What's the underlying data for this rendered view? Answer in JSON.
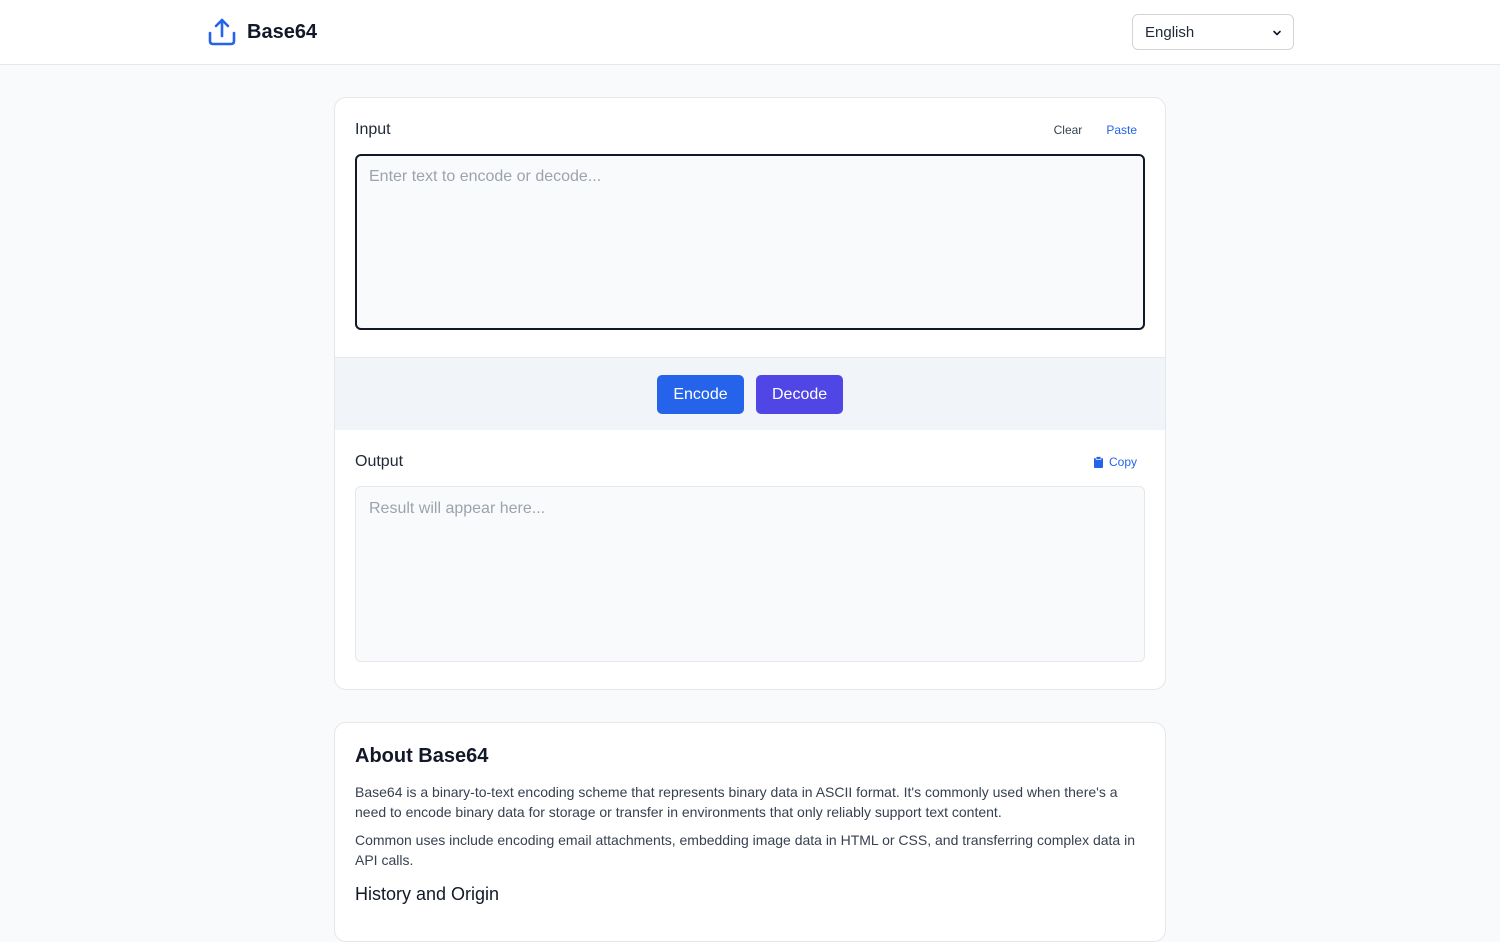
{
  "header": {
    "brand": "Base64",
    "brand_icon": "upload-tray-icon",
    "language": {
      "selected": "English"
    }
  },
  "converter": {
    "input": {
      "label": "Input",
      "clear_label": "Clear",
      "paste_label": "Paste",
      "placeholder": "Enter text to encode or decode...",
      "value": ""
    },
    "buttons": {
      "encode_label": "Encode",
      "decode_label": "Decode"
    },
    "output": {
      "label": "Output",
      "copy_label": "Copy",
      "copy_icon": "clipboard-icon",
      "placeholder": "Result will appear here...",
      "value": ""
    }
  },
  "about": {
    "title": "About Base64",
    "paragraphs": [
      "Base64 is a binary-to-text encoding scheme that represents binary data in ASCII format. It's commonly used when there's a need to encode binary data for storage or transfer in environments that only reliably support text content.",
      "Common uses include encoding email attachments, embedding image data in HTML or CSS, and transferring complex data in API calls."
    ],
    "subheading": "History and Origin"
  },
  "colors": {
    "primary": "#2563eb",
    "decode": "#4f46e5",
    "background": "#f8fafc"
  }
}
